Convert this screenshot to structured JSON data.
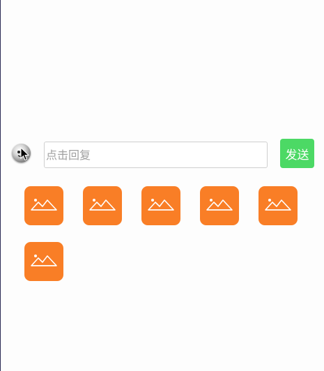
{
  "reply_bar": {
    "emoji_icon": "emoji-face-icon",
    "input_placeholder": "点击回复",
    "input_value": "",
    "send_label": "发送",
    "send_color": "#4cd965"
  },
  "image_grid": {
    "tile_color": "#f97e26",
    "icon": "image-picture-icon",
    "tile_count": 6
  }
}
